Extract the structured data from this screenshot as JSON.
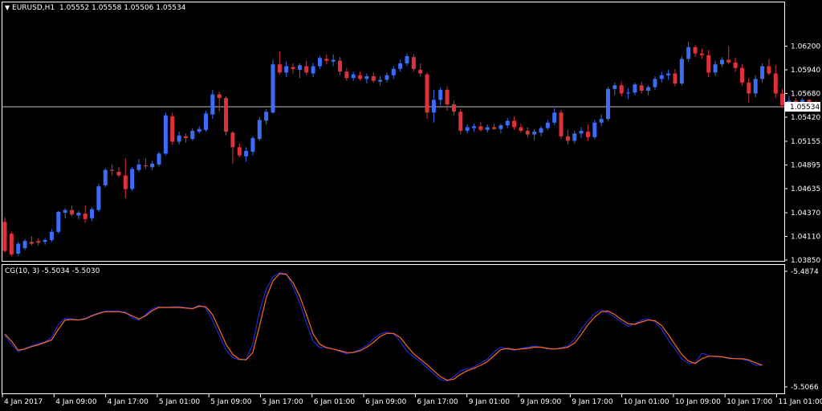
{
  "main_header": {
    "symbol_label": "EURUSD,H1",
    "ohlc": "1.05552 1.05558 1.05506 1.05534",
    "menu_icon": "triangle-down-icon"
  },
  "indicator_header": {
    "label": "CG(10, 3) -5.5034 -5.5030"
  },
  "current_price_label": "1.05534",
  "colors": {
    "background": "#000000",
    "frame": "#ffffff",
    "bull": "#3b6cf5",
    "bear": "#e0303a",
    "cg_main": "#1a2ad6",
    "cg_signal": "#ff6a1a",
    "price_line": "#c0c0c0"
  },
  "chart_data": [
    {
      "type": "candlestick",
      "title": "EURUSD,H1",
      "ylim": [
        1.0385,
        1.0646
      ],
      "y_ticks": [
        "1.06200",
        "1.05940",
        "1.05680",
        "1.05420",
        "1.05155",
        "1.04895",
        "1.04635",
        "1.04370",
        "1.04110",
        "1.03850"
      ],
      "y_tick_values": [
        1.062,
        1.0594,
        1.0568,
        1.0542,
        1.05155,
        1.04895,
        1.04635,
        1.0437,
        1.0411,
        1.0385
      ],
      "current_price": 1.05534,
      "candles": [
        [
          1.0427,
          1.0432,
          1.0393,
          1.0395
        ],
        [
          1.0414,
          1.0416,
          1.0389,
          1.0391
        ],
        [
          1.0392,
          1.0405,
          1.039,
          1.0403
        ],
        [
          1.0398,
          1.0408,
          1.0396,
          1.0406
        ],
        [
          1.0405,
          1.0411,
          1.0401,
          1.0403
        ],
        [
          1.0406,
          1.0409,
          1.0401,
          1.0404
        ],
        [
          1.0405,
          1.0409,
          1.0402,
          1.0407
        ],
        [
          1.0407,
          1.0419,
          1.0405,
          1.0416
        ],
        [
          1.0416,
          1.0439,
          1.0414,
          1.0438
        ],
        [
          1.0437,
          1.0442,
          1.0431,
          1.044
        ],
        [
          1.044,
          1.0445,
          1.0433,
          1.0435
        ],
        [
          1.0434,
          1.0439,
          1.043,
          1.0437
        ],
        [
          1.0436,
          1.0445,
          1.0426,
          1.043
        ],
        [
          1.0431,
          1.0443,
          1.0428,
          1.0441
        ],
        [
          1.044,
          1.0469,
          1.0438,
          1.0466
        ],
        [
          1.0467,
          1.0486,
          1.0465,
          1.0484
        ],
        [
          1.0484,
          1.049,
          1.0478,
          1.0483
        ],
        [
          1.0482,
          1.0487,
          1.0476,
          1.0478
        ],
        [
          1.0478,
          1.0497,
          1.0453,
          1.0463
        ],
        [
          1.0463,
          1.0487,
          1.0461,
          1.0485
        ],
        [
          1.0484,
          1.0496,
          1.0482,
          1.049
        ],
        [
          1.0489,
          1.0497,
          1.0485,
          1.0488
        ],
        [
          1.0487,
          1.0494,
          1.0484,
          1.0491
        ],
        [
          1.049,
          1.0504,
          1.0488,
          1.0502
        ],
        [
          1.0502,
          1.0547,
          1.05,
          1.0544
        ],
        [
          1.0543,
          1.0547,
          1.0512,
          1.0515
        ],
        [
          1.0515,
          1.0526,
          1.0512,
          1.0522
        ],
        [
          1.0521,
          1.0524,
          1.0514,
          1.0519
        ],
        [
          1.0518,
          1.053,
          1.0516,
          1.0527
        ],
        [
          1.0526,
          1.0532,
          1.0524,
          1.0529
        ],
        [
          1.0528,
          1.0549,
          1.0526,
          1.0546
        ],
        [
          1.0545,
          1.0572,
          1.054,
          1.0567
        ],
        [
          1.0567,
          1.057,
          1.0548,
          1.0563
        ],
        [
          1.0563,
          1.0565,
          1.0522,
          1.0526
        ],
        [
          1.0525,
          1.0527,
          1.0491,
          1.0509
        ],
        [
          1.0509,
          1.0513,
          1.0498,
          1.05
        ],
        [
          1.0499,
          1.0509,
          1.0493,
          1.0505
        ],
        [
          1.0504,
          1.0521,
          1.05,
          1.0519
        ],
        [
          1.0518,
          1.0542,
          1.0516,
          1.0539
        ],
        [
          1.0538,
          1.0551,
          1.0534,
          1.0548
        ],
        [
          1.0547,
          1.0605,
          1.0546,
          1.06
        ],
        [
          1.06,
          1.0614,
          1.0589,
          1.0591
        ],
        [
          1.0591,
          1.0603,
          1.0586,
          1.0598
        ],
        [
          1.0597,
          1.0601,
          1.059,
          1.0595
        ],
        [
          1.0594,
          1.0601,
          1.0585,
          1.0599
        ],
        [
          1.0598,
          1.0604,
          1.0588,
          1.0591
        ],
        [
          1.059,
          1.0602,
          1.0586,
          1.0598
        ],
        [
          1.0598,
          1.0609,
          1.0595,
          1.0607
        ],
        [
          1.0606,
          1.0611,
          1.06,
          1.0604
        ],
        [
          1.0603,
          1.0611,
          1.0598,
          1.0605
        ],
        [
          1.0604,
          1.0608,
          1.0588,
          1.0592
        ],
        [
          1.0592,
          1.0596,
          1.0582,
          1.0585
        ],
        [
          1.0585,
          1.0592,
          1.0582,
          1.0589
        ],
        [
          1.0588,
          1.0592,
          1.0582,
          1.0584
        ],
        [
          1.0584,
          1.059,
          1.0579,
          1.0587
        ],
        [
          1.0587,
          1.0591,
          1.058,
          1.0582
        ],
        [
          1.0581,
          1.0587,
          1.0577,
          1.0583
        ],
        [
          1.0583,
          1.0591,
          1.058,
          1.0588
        ],
        [
          1.0588,
          1.0598,
          1.0584,
          1.0595
        ],
        [
          1.0595,
          1.0605,
          1.0592,
          1.0601
        ],
        [
          1.0601,
          1.0612,
          1.0598,
          1.0609
        ],
        [
          1.0608,
          1.0611,
          1.0592,
          1.0595
        ],
        [
          1.0594,
          1.0601,
          1.0587,
          1.059
        ],
        [
          1.0589,
          1.0591,
          1.054,
          1.0547
        ],
        [
          1.0547,
          1.0572,
          1.0536,
          1.0561
        ],
        [
          1.0561,
          1.0575,
          1.0555,
          1.0572
        ],
        [
          1.0572,
          1.0576,
          1.0549,
          1.0556
        ],
        [
          1.0556,
          1.056,
          1.0544,
          1.0548
        ],
        [
          1.0548,
          1.0551,
          1.0523,
          1.0527
        ],
        [
          1.0527,
          1.0534,
          1.0524,
          1.0531
        ],
        [
          1.053,
          1.0535,
          1.0526,
          1.0532
        ],
        [
          1.0532,
          1.0536,
          1.0526,
          1.0528
        ],
        [
          1.0528,
          1.0534,
          1.0525,
          1.0531
        ],
        [
          1.0531,
          1.0535,
          1.0528,
          1.0529
        ],
        [
          1.0529,
          1.0535,
          1.0524,
          1.0533
        ],
        [
          1.0533,
          1.0541,
          1.053,
          1.0538
        ],
        [
          1.0538,
          1.0543,
          1.0528,
          1.0531
        ],
        [
          1.0531,
          1.0535,
          1.0525,
          1.0527
        ],
        [
          1.0527,
          1.0531,
          1.052,
          1.0523
        ],
        [
          1.0523,
          1.0529,
          1.0517,
          1.0526
        ],
        [
          1.0525,
          1.0532,
          1.0521,
          1.053
        ],
        [
          1.053,
          1.0539,
          1.0528,
          1.0536
        ],
        [
          1.0536,
          1.0552,
          1.0533,
          1.0547
        ],
        [
          1.0547,
          1.055,
          1.0518,
          1.0521
        ],
        [
          1.0521,
          1.0528,
          1.0512,
          1.0516
        ],
        [
          1.0516,
          1.0527,
          1.0513,
          1.0524
        ],
        [
          1.0524,
          1.0531,
          1.0519,
          1.0527
        ],
        [
          1.0526,
          1.0534,
          1.0516,
          1.052
        ],
        [
          1.052,
          1.0539,
          1.0518,
          1.0536
        ],
        [
          1.0536,
          1.0545,
          1.0532,
          1.054
        ],
        [
          1.054,
          1.0575,
          1.0538,
          1.0573
        ],
        [
          1.0573,
          1.058,
          1.0566,
          1.0577
        ],
        [
          1.0577,
          1.0581,
          1.0565,
          1.0568
        ],
        [
          1.0568,
          1.0574,
          1.0562,
          1.0569
        ],
        [
          1.0569,
          1.058,
          1.0566,
          1.0578
        ],
        [
          1.0577,
          1.0581,
          1.0568,
          1.0571
        ],
        [
          1.0571,
          1.0577,
          1.0566,
          1.0575
        ],
        [
          1.0575,
          1.0587,
          1.0572,
          1.0584
        ],
        [
          1.0584,
          1.0592,
          1.058,
          1.0588
        ],
        [
          1.0588,
          1.0594,
          1.0583,
          1.059
        ],
        [
          1.059,
          1.0595,
          1.0576,
          1.0579
        ],
        [
          1.0579,
          1.0609,
          1.0577,
          1.0606
        ],
        [
          1.0606,
          1.0625,
          1.0603,
          1.0619
        ],
        [
          1.0619,
          1.0621,
          1.0608,
          1.0612
        ],
        [
          1.0612,
          1.0617,
          1.0606,
          1.061
        ],
        [
          1.061,
          1.0616,
          1.0586,
          1.0591
        ],
        [
          1.0591,
          1.0604,
          1.0587,
          1.06
        ],
        [
          1.06,
          1.0608,
          1.0597,
          1.0605
        ],
        [
          1.0605,
          1.062,
          1.06,
          1.0602
        ],
        [
          1.0602,
          1.0607,
          1.0592,
          1.0596
        ],
        [
          1.0596,
          1.06,
          1.0577,
          1.058
        ],
        [
          1.058,
          1.0585,
          1.0558,
          1.0568
        ],
        [
          1.0568,
          1.0588,
          1.0564,
          1.0584
        ],
        [
          1.0584,
          1.0601,
          1.058,
          1.0598
        ],
        [
          1.0598,
          1.0606,
          1.0588,
          1.059
        ],
        [
          1.059,
          1.0599,
          1.0563,
          1.0568
        ],
        [
          1.0568,
          1.0573,
          1.0552,
          1.0555
        ],
        [
          1.0555,
          1.0565,
          1.0552,
          1.056
        ],
        [
          1.056,
          1.0563,
          1.0555,
          1.0557
        ],
        [
          1.0557,
          1.0563,
          1.0554,
          1.0561
        ],
        [
          1.0561,
          1.0562,
          1.0552,
          1.0555
        ],
        [
          1.0555,
          1.056,
          1.0551,
          1.0553
        ]
      ]
    },
    {
      "type": "line",
      "title": "CG(10, 3)",
      "ylim": [
        -5.5066,
        -5.4874
      ],
      "y_ticks": [
        "-5.4874",
        "-5.5066"
      ],
      "y_tick_values": [
        -5.4874,
        -5.5066
      ],
      "series": [
        {
          "values": [
            -5.498,
            -5.4995,
            -5.5008,
            -5.5002,
            -5.4998,
            -5.4994,
            -5.4991,
            -5.4984,
            -5.4962,
            -5.4952,
            -5.4953,
            -5.4955,
            -5.4952,
            -5.4947,
            -5.4943,
            -5.494,
            -5.494,
            -5.494,
            -5.4942,
            -5.4951,
            -5.4955,
            -5.4946,
            -5.4936,
            -5.4933,
            -5.4934,
            -5.4933,
            -5.4933,
            -5.4934,
            -5.4936,
            -5.493,
            -5.4935,
            -5.4956,
            -5.498,
            -5.5005,
            -5.5017,
            -5.5021,
            -5.502,
            -5.4995,
            -5.494,
            -5.4904,
            -5.4883,
            -5.4876,
            -5.4878,
            -5.49,
            -5.4926,
            -5.496,
            -5.499,
            -5.5001,
            -5.5,
            -5.5003,
            -5.5007,
            -5.5011,
            -5.5008,
            -5.5004,
            -5.4997,
            -5.4986,
            -5.4978,
            -5.4975,
            -5.4978,
            -5.499,
            -5.5007,
            -5.5016,
            -5.5024,
            -5.5034,
            -5.5044,
            -5.5054,
            -5.5056,
            -5.5049,
            -5.5039,
            -5.5036,
            -5.5033,
            -5.5026,
            -5.502,
            -5.5008,
            -5.5,
            -5.5003,
            -5.5005,
            -5.5002,
            -5.5,
            -5.4998,
            -5.5,
            -5.5003,
            -5.5003,
            -5.5001,
            -5.4998,
            -5.4987,
            -5.497,
            -5.4956,
            -5.4944,
            -5.4938,
            -5.4943,
            -5.495,
            -5.4958,
            -5.4965,
            -5.4961,
            -5.4955,
            -5.4953,
            -5.4958,
            -5.497,
            -5.4988,
            -5.5003,
            -5.5019,
            -5.5027,
            -5.5026,
            -5.501,
            -5.5014,
            -5.5016,
            -5.5016,
            -5.5019,
            -5.5019,
            -5.502,
            -5.5023,
            -5.503,
            -5.503
          ]
        },
        {
          "values": [
            -5.4978,
            -5.499,
            -5.5005,
            -5.5003,
            -5.4999,
            -5.4996,
            -5.4992,
            -5.4988,
            -5.497,
            -5.4955,
            -5.4954,
            -5.4955,
            -5.4953,
            -5.4948,
            -5.4944,
            -5.4941,
            -5.4941,
            -5.4941,
            -5.4943,
            -5.4948,
            -5.4953,
            -5.4948,
            -5.4939,
            -5.4934,
            -5.4934,
            -5.4934,
            -5.4934,
            -5.4935,
            -5.4936,
            -5.4932,
            -5.4933,
            -5.4946,
            -5.497,
            -5.4995,
            -5.5012,
            -5.502,
            -5.5021,
            -5.5009,
            -5.4965,
            -5.4918,
            -5.489,
            -5.4878,
            -5.4879,
            -5.4893,
            -5.4915,
            -5.4946,
            -5.4978,
            -5.4995,
            -5.5001,
            -5.5003,
            -5.5006,
            -5.5009,
            -5.5009,
            -5.5006,
            -5.5,
            -5.4992,
            -5.4982,
            -5.4977,
            -5.4977,
            -5.4984,
            -5.4998,
            -5.5011,
            -5.502,
            -5.5029,
            -5.5039,
            -5.5049,
            -5.5055,
            -5.5053,
            -5.5045,
            -5.5039,
            -5.5035,
            -5.503,
            -5.5024,
            -5.5014,
            -5.5004,
            -5.5002,
            -5.5004,
            -5.5003,
            -5.5002,
            -5.5,
            -5.5,
            -5.5002,
            -5.5003,
            -5.5002,
            -5.5,
            -5.4993,
            -5.4979,
            -5.4963,
            -5.495,
            -5.4941,
            -5.494,
            -5.4946,
            -5.4954,
            -5.4961,
            -5.4962,
            -5.4958,
            -5.4955,
            -5.4956,
            -5.4964,
            -5.4979,
            -5.4996,
            -5.5012,
            -5.5023,
            -5.5027,
            -5.5019,
            -5.5015,
            -5.5015,
            -5.5016,
            -5.5018,
            -5.5019,
            -5.5019,
            -5.5021,
            -5.5026,
            -5.503
          ]
        }
      ]
    }
  ],
  "x_axis_labels": [
    "4 Jan 2017",
    "4 Jan 09:00",
    "4 Jan 17:00",
    "5 Jan 01:00",
    "5 Jan 09:00",
    "5 Jan 17:00",
    "6 Jan 01:00",
    "6 Jan 09:00",
    "6 Jan 17:00",
    "9 Jan 01:00",
    "9 Jan 09:00",
    "9 Jan 17:00",
    "10 Jan 01:00",
    "10 Jan 09:00",
    "10 Jan 17:00",
    "11 Jan 01:00"
  ]
}
